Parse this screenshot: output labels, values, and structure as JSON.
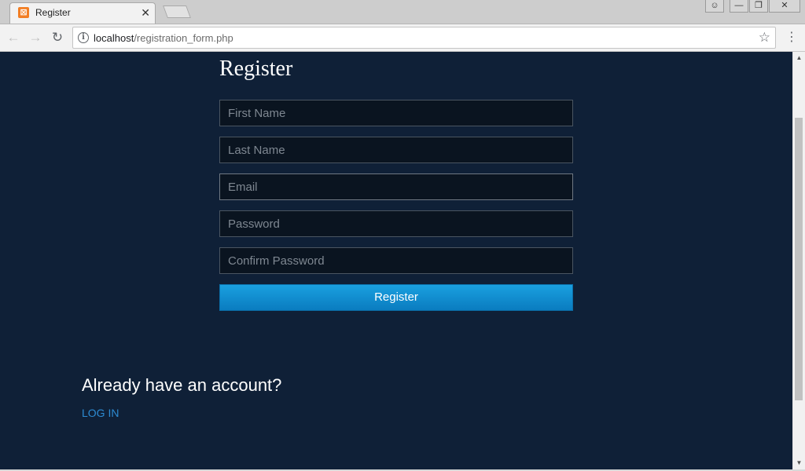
{
  "browser": {
    "tab_title": "Register",
    "url_host": "localhost",
    "url_path": "/registration_form.php"
  },
  "page": {
    "title": "Register",
    "fields": [
      {
        "placeholder": "First Name"
      },
      {
        "placeholder": "Last Name"
      },
      {
        "placeholder": "Email"
      },
      {
        "placeholder": "Password"
      },
      {
        "placeholder": "Confirm Password"
      }
    ],
    "submit_label": "Register",
    "login_prompt": "Already have an account?",
    "login_link": "LOG IN"
  },
  "icons": {
    "favicon": "xampp-icon",
    "tab_close": "close-icon",
    "back": "back-arrow-icon",
    "forward": "forward-arrow-icon",
    "reload": "reload-icon",
    "info": "info-icon",
    "star": "star-icon",
    "menu": "kebab-menu-icon"
  },
  "colors": {
    "page_background": "#0f2037",
    "field_background": "#0a1420",
    "button_blue": "#1a95d8",
    "link_blue": "#2d8bd2"
  }
}
